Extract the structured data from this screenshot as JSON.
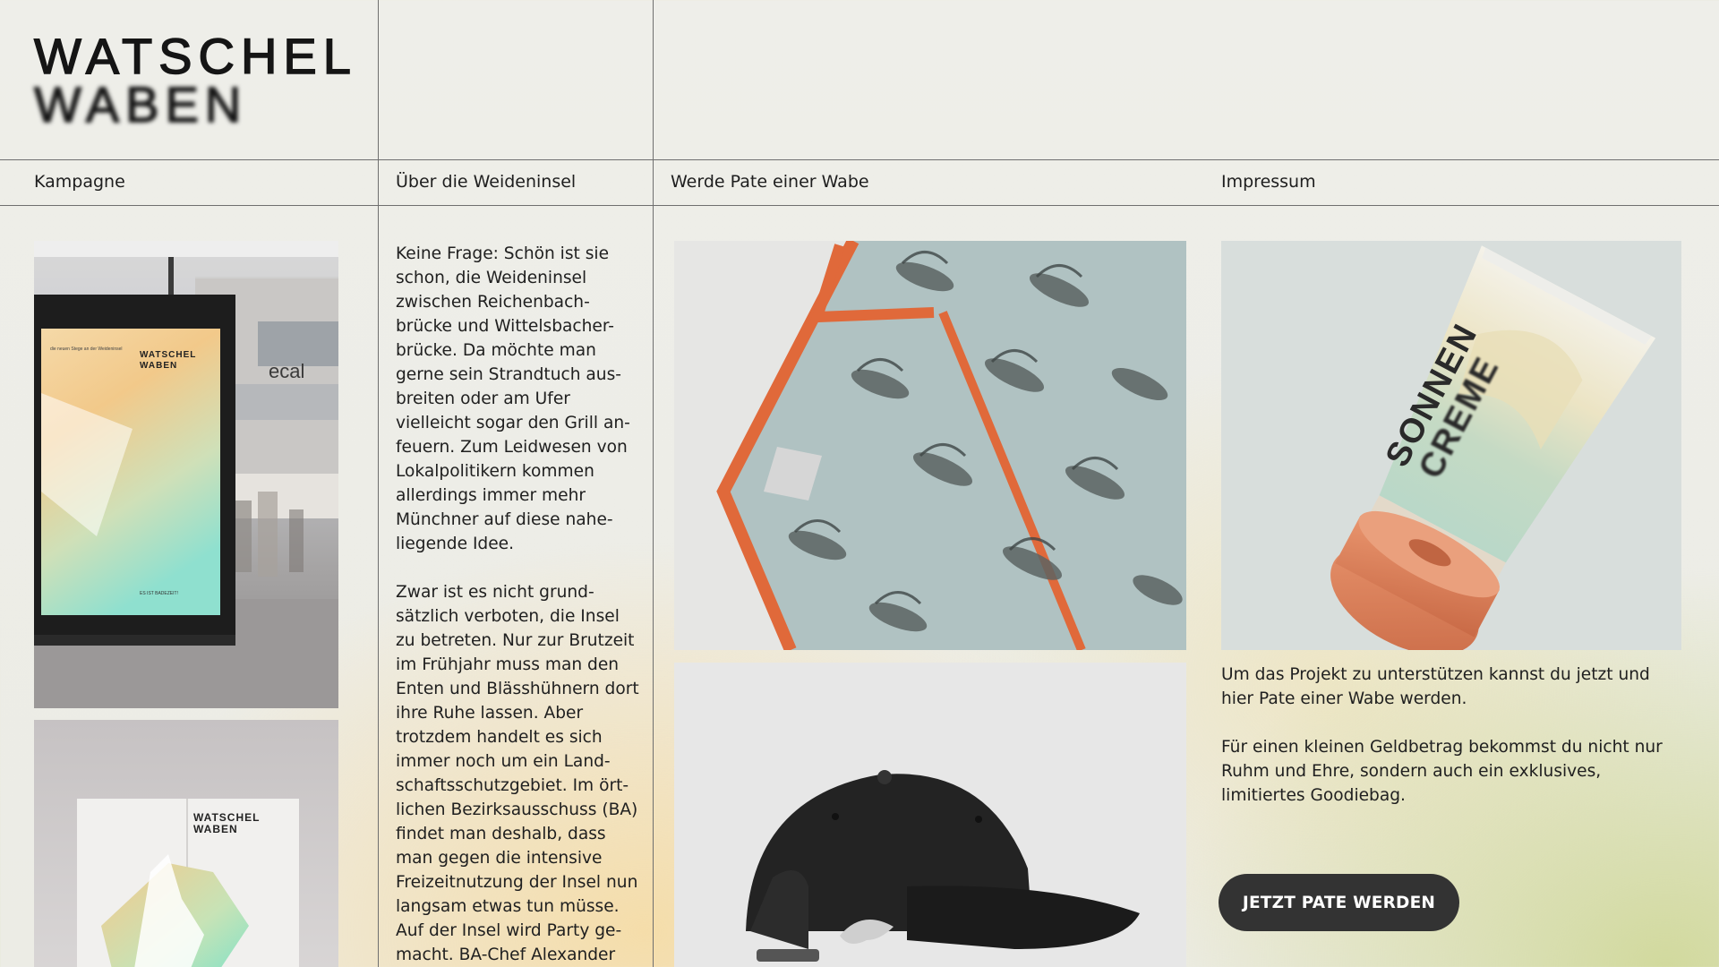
{
  "brand": {
    "line1": "WATSCHEL",
    "line2": "WABEN"
  },
  "nav": {
    "items": [
      {
        "label": "Kampagne"
      },
      {
        "label": "Über die Weideninsel"
      },
      {
        "label": "Werde Pate einer Wabe"
      },
      {
        "label": "Impressum"
      }
    ]
  },
  "about": {
    "paragraphs": [
      "Keine Frage: Schön ist sie schon, die Weideninsel zwischen Reichenbach-brücke und Wittelsbacher-brücke. Da möchte man gerne sein Strandtuch aus-breiten oder am Ufer vielleicht sogar den Grill an-feuern. Zum Leidwesen von Lokalpolitikern kommen allerdings immer mehr Münchner auf diese nahe-liegende Idee.",
      "Zwar ist es nicht grund-sätzlich verboten, die Insel zu betreten. Nur zur Brutzeit im Frühjahr muss man den Enten und Blässhühnern dort ihre Ruhe lassen. Aber trotzdem handelt es sich immer noch um ein Land-schaftsschutzgebiet. Im ört-lichen Bezirksausschuss (BA) findet man deshalb, dass man gegen die intensive Freizeitnutzung der Insel nun langsam etwas tun müsse. Auf der Insel wird Party ge-macht. BA-Chef Alexander"
    ]
  },
  "mockups": {
    "poster_brand_line1": "WATSCHEL",
    "poster_brand_line2": "WABEN",
    "poster_small_text": "die neuen Stege an der Weideninsel",
    "poster_footer": "ES IST BADEZEIT!",
    "store_sign": "ecal",
    "tube_line1": "SONNEN",
    "tube_line2": "CREME"
  },
  "support": {
    "paragraphs": [
      "Um das Projekt zu unterstützen kannst du jetzt und hier Pate einer Wabe werden.",
      "Für einen kleinen Geldbetrag bekommst du nicht nur Ruhm und Ehre, sondern auch ein exklusives, limitiertes Goodiebag."
    ],
    "cta_label": "JETZT PATE WERDEN"
  },
  "colors": {
    "accent_orange": "#e0693a",
    "button_bg": "#333333",
    "line": "#6f6f6f"
  }
}
